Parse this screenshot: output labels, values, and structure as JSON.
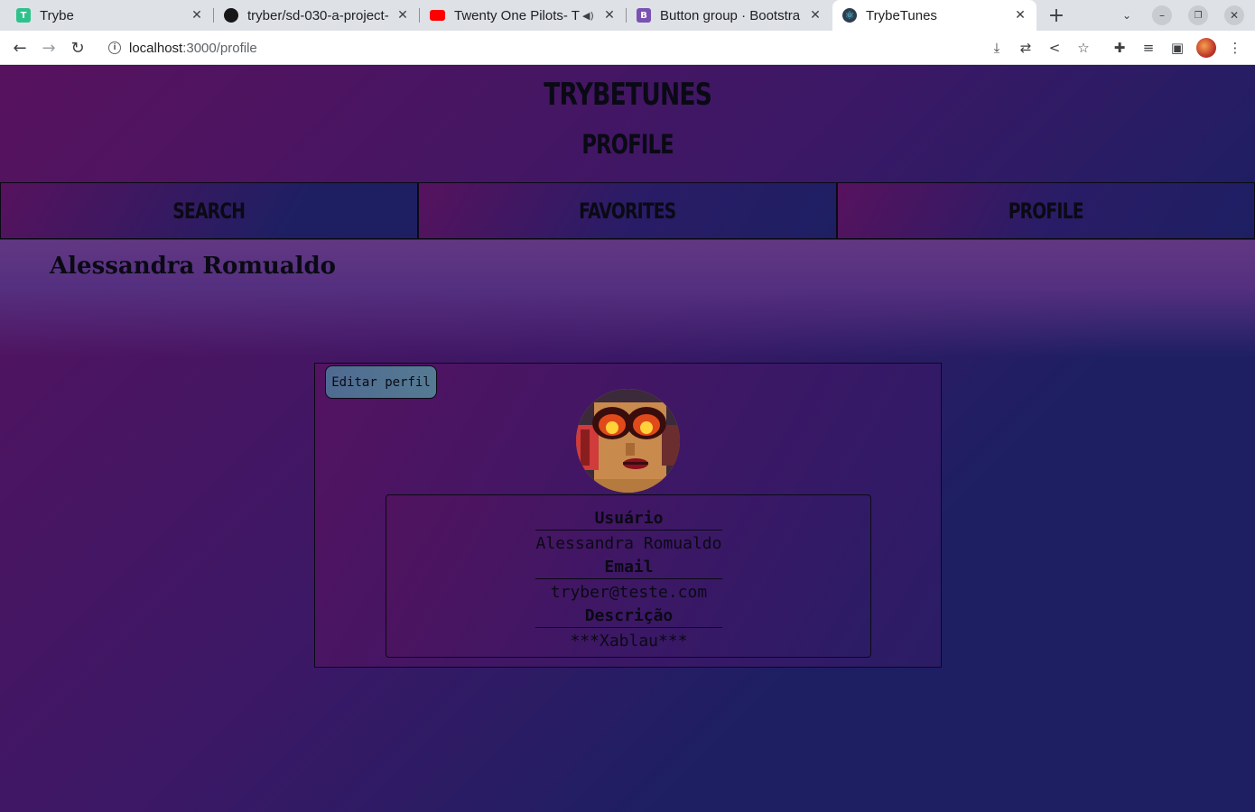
{
  "browser": {
    "tabs": [
      {
        "title": "Trybe",
        "favicon": "trybe-icon",
        "color": "#2fc18c"
      },
      {
        "title": "tryber/sd-030-a-project-",
        "favicon": "github-icon",
        "color": "#181717"
      },
      {
        "title": "Twenty One Pilots- T",
        "favicon": "youtube-icon",
        "color": "#ff0000"
      },
      {
        "title": "Button group · Bootstra",
        "favicon": "bootstrap-icon",
        "color": "#7952b3"
      },
      {
        "title": "TrybeTunes",
        "favicon": "react-icon",
        "color": "#61dafb"
      }
    ],
    "url_host": "localhost",
    "url_path": ":3000/profile"
  },
  "header": {
    "title": "TrybeTunes",
    "subtitle": "Profile"
  },
  "nav": {
    "search": "Search",
    "favorites": "Favorites",
    "profile": "Profile"
  },
  "user": {
    "name": "Alessandra Romualdo"
  },
  "card": {
    "edit_label": "Editar perfil",
    "fields": {
      "user_label": "Usuário",
      "user_value": "Alessandra Romualdo",
      "email_label": "Email",
      "email_value": "tryber@teste.com",
      "desc_label": "Descrição",
      "desc_value": "***Xablau***"
    }
  },
  "colors": {
    "gradient_start": "#57125e",
    "gradient_end": "#1e1f63",
    "edit_button": "#557b93"
  }
}
